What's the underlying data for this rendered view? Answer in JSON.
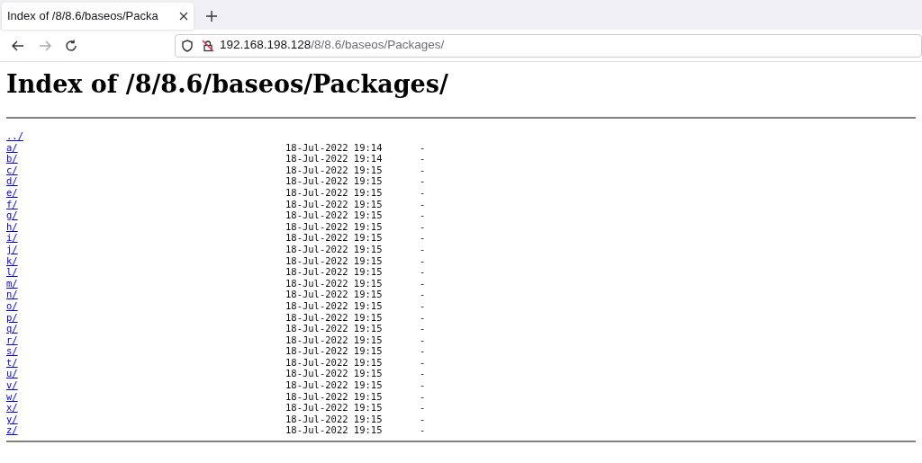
{
  "tab": {
    "title": "Index of /8/8.6/baseos/Packa",
    "selected": true
  },
  "url": {
    "host": "192.168.198.128",
    "path": "/8/8.6/baseos/Packages/"
  },
  "heading": "Index of /8/8.6/baseos/Packages/",
  "entries": [
    {
      "name": "../"
    },
    {
      "name": "a/",
      "date": "18-Jul-2022 19:14",
      "size": "-"
    },
    {
      "name": "b/",
      "date": "18-Jul-2022 19:14",
      "size": "-"
    },
    {
      "name": "c/",
      "date": "18-Jul-2022 19:15",
      "size": "-"
    },
    {
      "name": "d/",
      "date": "18-Jul-2022 19:15",
      "size": "-"
    },
    {
      "name": "e/",
      "date": "18-Jul-2022 19:15",
      "size": "-"
    },
    {
      "name": "f/",
      "date": "18-Jul-2022 19:15",
      "size": "-"
    },
    {
      "name": "g/",
      "date": "18-Jul-2022 19:15",
      "size": "-"
    },
    {
      "name": "h/",
      "date": "18-Jul-2022 19:15",
      "size": "-"
    },
    {
      "name": "i/",
      "date": "18-Jul-2022 19:15",
      "size": "-"
    },
    {
      "name": "j/",
      "date": "18-Jul-2022 19:15",
      "size": "-"
    },
    {
      "name": "k/",
      "date": "18-Jul-2022 19:15",
      "size": "-"
    },
    {
      "name": "l/",
      "date": "18-Jul-2022 19:15",
      "size": "-"
    },
    {
      "name": "m/",
      "date": "18-Jul-2022 19:15",
      "size": "-"
    },
    {
      "name": "n/",
      "date": "18-Jul-2022 19:15",
      "size": "-"
    },
    {
      "name": "o/",
      "date": "18-Jul-2022 19:15",
      "size": "-"
    },
    {
      "name": "p/",
      "date": "18-Jul-2022 19:15",
      "size": "-"
    },
    {
      "name": "q/",
      "date": "18-Jul-2022 19:15",
      "size": "-"
    },
    {
      "name": "r/",
      "date": "18-Jul-2022 19:15",
      "size": "-"
    },
    {
      "name": "s/",
      "date": "18-Jul-2022 19:15",
      "size": "-"
    },
    {
      "name": "t/",
      "date": "18-Jul-2022 19:15",
      "size": "-"
    },
    {
      "name": "u/",
      "date": "18-Jul-2022 19:15",
      "size": "-"
    },
    {
      "name": "v/",
      "date": "18-Jul-2022 19:15",
      "size": "-"
    },
    {
      "name": "w/",
      "date": "18-Jul-2022 19:15",
      "size": "-"
    },
    {
      "name": "x/",
      "date": "18-Jul-2022 19:15",
      "size": "-"
    },
    {
      "name": "y/",
      "date": "18-Jul-2022 19:15",
      "size": "-"
    },
    {
      "name": "z/",
      "date": "18-Jul-2022 19:15",
      "size": "-"
    }
  ]
}
